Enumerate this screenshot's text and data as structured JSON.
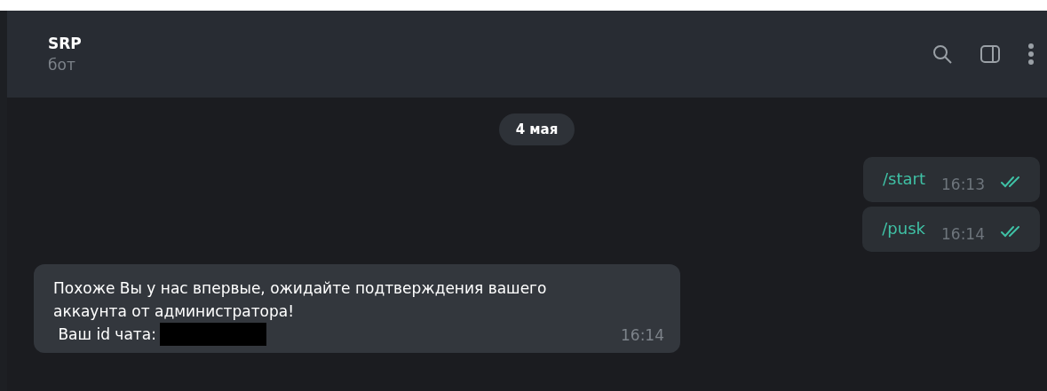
{
  "header": {
    "title": "SRP",
    "subtitle": "бот"
  },
  "date_pill": "4 мая",
  "messages": [
    {
      "kind": "outgoing",
      "text": "/start",
      "time": "16:13",
      "read": true
    },
    {
      "kind": "outgoing",
      "text": "/pusk",
      "time": "16:14",
      "read": true
    },
    {
      "kind": "incoming",
      "text": "Похоже Вы у нас впервые, ожидайте подтверждения вашего\nаккаунта от администратора!\n Ваш id чата:",
      "time": "16:14",
      "redacted": true
    }
  ]
}
